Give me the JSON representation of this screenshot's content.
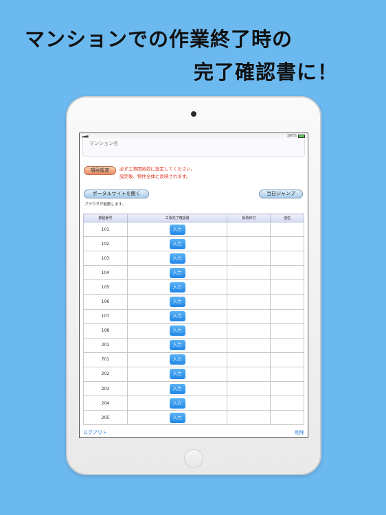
{
  "headline": {
    "line1": "マンションでの作業終了時の",
    "line2": "完了確認書に！"
  },
  "status_bar": {
    "battery_text": "100%"
  },
  "form": {
    "name_placeholder": "マンション名",
    "settings_button": "項目設定",
    "warning_line1": "必ず工事開始前に設定してください。",
    "warning_line2": "設定後、物件全体に反映されます。",
    "portal_button": "ポータルサイトを開く",
    "jump_button": "当日ジャンプ",
    "browser_note": "ブラウザが起動します。"
  },
  "table": {
    "headers": [
      "部屋番号",
      "工事完了確認書",
      "受領日付",
      "送信"
    ],
    "rows": [
      {
        "room": "101",
        "action": "入力"
      },
      {
        "room": "102",
        "action": "入力"
      },
      {
        "room": "103",
        "action": "入力"
      },
      {
        "room": "104",
        "action": "入力"
      },
      {
        "room": "105",
        "action": "入力"
      },
      {
        "room": "106",
        "action": "入力"
      },
      {
        "room": "107",
        "action": "入力"
      },
      {
        "room": "108",
        "action": "入力"
      },
      {
        "room": "201",
        "action": "入力"
      },
      {
        "room": "701",
        "action": "入力"
      },
      {
        "room": "202",
        "action": "入力"
      },
      {
        "room": "203",
        "action": "入力"
      },
      {
        "room": "204",
        "action": "入力"
      },
      {
        "room": "205",
        "action": "入力"
      }
    ]
  },
  "footer": {
    "logout": "ログアウト",
    "delete": "削除"
  },
  "colors": {
    "background": "#6cb9f0",
    "button_blue": "#2187e6",
    "warning_red": "#e0301e",
    "link_blue": "#2a7fd6"
  }
}
